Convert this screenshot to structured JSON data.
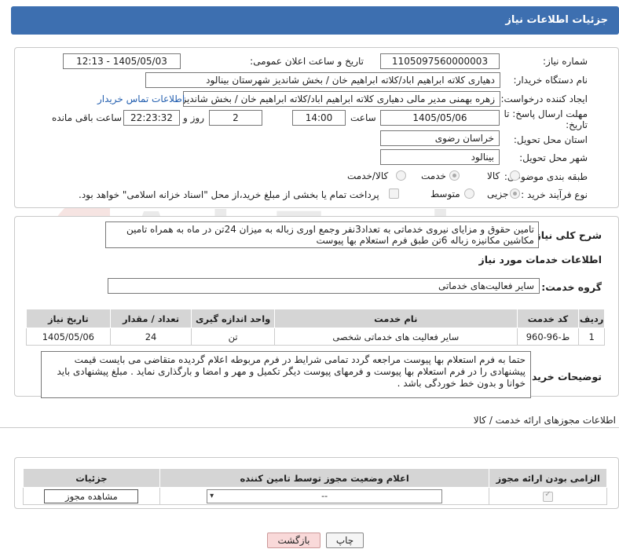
{
  "header": {
    "title": "جزئیات اطلاعات نیاز"
  },
  "form": {
    "need_number_label": "شماره نیاز:",
    "need_number": "1105097560000003",
    "announce_label": "تاریخ و ساعت اعلان عمومی:",
    "announce_value": "1405/05/03 - 12:13",
    "buyer_org_label": "نام دستگاه خریدار:",
    "buyer_org": "دهیاری کلاته ابراهیم اباد/کلاته ابراهیم خان / بخش شاندیز شهرستان بینالود",
    "creator_label": "ایجاد کننده درخواست:",
    "creator": "زهره بهمنی مدیر مالی دهیاری کلاته ابراهیم اباد/کلاته ابراهیم خان / بخش شاندیز",
    "contact_link": "اطلاعات تماس خریدار",
    "deadline_label_1": "مهلت ارسال پاسخ: تا",
    "deadline_label_2": "تاریخ:",
    "deadline_date": "1405/05/06",
    "time_label": "ساعت",
    "deadline_time": "14:00",
    "days_value": "2",
    "days_label": "روز و",
    "remaining_time": "22:23:32",
    "remaining_label": "ساعت باقی مانده",
    "province_label": "استان محل تحویل:",
    "province": "خراسان رضوی",
    "city_label": "شهر محل تحویل:",
    "city": "بینالود",
    "category_label": "طبقه بندی موضوعی:",
    "category_options": [
      "کالا",
      "خدمت",
      "کالا/خدمت"
    ],
    "category_selected": "خدمت",
    "process_label": "نوع فرآیند خرید :",
    "process_options": [
      "جزیی",
      "متوسط"
    ],
    "process_selected": "جزیی",
    "payment_note": "پرداخت تمام یا بخشی از مبلغ خرید،از محل \"اسناد خزانه اسلامی\" خواهد بود."
  },
  "description": {
    "label": "شرح کلی نیاز:",
    "text": "تامین حقوق و مزایای نیروی خدماتی به تعداد3نفر وجمع اوری زباله به میزان 24تن در ماه به همراه تامین مکاشین مکانیزه زباله 6تن طبق فرم استعلام بها پیوست"
  },
  "services": {
    "section_title": "اطلاعات خدمات مورد نیاز",
    "group_label": "گروه خدمت:",
    "group_value": "سایر فعالیت‌های خدماتی",
    "columns": [
      "ردیف",
      "کد خدمت",
      "نام خدمت",
      "واحد اندازه گیری",
      "تعداد / مقدار",
      "تاریخ نیاز"
    ],
    "rows": [
      [
        "1",
        "ط-96-960",
        "سایر فعالیت های خدماتی شخصی",
        "تن",
        "24",
        "1405/05/06"
      ]
    ]
  },
  "buyer_notes": {
    "label": "توضیحات خریدار:",
    "text": "حتما به فرم استعلام بها پیوست مراجعه گردد تمامی شرایط در فرم مربوطه اعلام گردیده متقاضی می بایست قیمت پیشنهادی را در فرم استعلام بها پیوست و فرمهای پیوست دیگر تکمیل و مهر و امضا و بارگذاری نماید . مبلغ پیشنهادی باید خوانا و بدون خط خوردگی باشد ."
  },
  "permits": {
    "section_title": "اطلاعات مجوزهای ارائه خدمت / کالا",
    "columns": [
      "الزامی بودن ارائه مجوز",
      "اعلام وضعیت مجوز توسط تامین کننده",
      "جزئیات"
    ],
    "select_value": "--",
    "view_button": "مشاهده مجوز"
  },
  "footer": {
    "print_label": "چاپ",
    "back_label": "بازگشت"
  },
  "watermark": {
    "text": "AriaTender.net"
  }
}
